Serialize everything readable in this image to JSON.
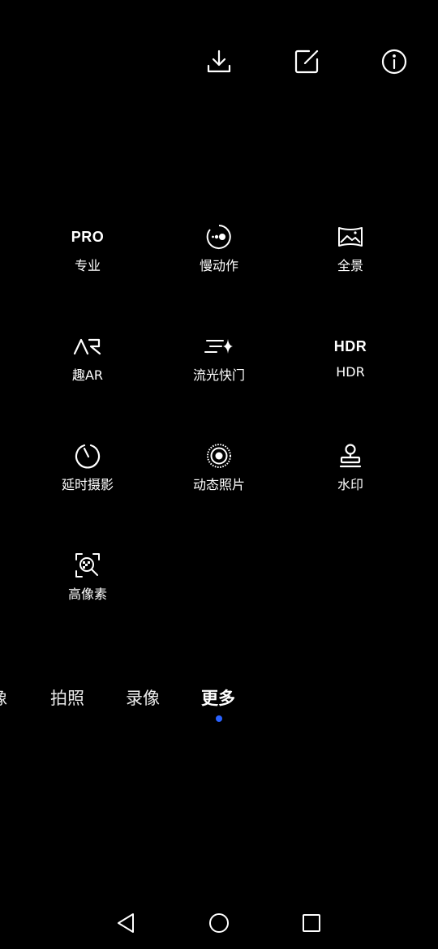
{
  "toolbar": {
    "download_icon": "download-icon",
    "edit_icon": "edit-icon",
    "info_icon": "info-icon"
  },
  "modes": [
    {
      "label": "专业",
      "icon": "pro-icon",
      "icon_text": "PRO"
    },
    {
      "label": "慢动作",
      "icon": "slow-motion-icon"
    },
    {
      "label": "全景",
      "icon": "panorama-icon"
    },
    {
      "label": "趣AR",
      "icon": "ar-icon"
    },
    {
      "label": "流光快门",
      "icon": "light-trail-icon"
    },
    {
      "label": "HDR",
      "icon": "hdr-icon",
      "icon_text": "HDR"
    },
    {
      "label": "延时摄影",
      "icon": "time-lapse-icon"
    },
    {
      "label": "动态照片",
      "icon": "live-photo-icon"
    },
    {
      "label": "水印",
      "icon": "watermark-icon"
    },
    {
      "label": "高像素",
      "icon": "high-resolution-icon"
    }
  ],
  "mode_selector": {
    "tabs": [
      {
        "label": "像"
      },
      {
        "label": "拍照"
      },
      {
        "label": "录像"
      },
      {
        "label": "更多",
        "active": true
      }
    ],
    "active_dot_color": "#2a62ff"
  },
  "nav_bar": {
    "back_icon": "back-triangle-icon",
    "home_icon": "home-circle-icon",
    "recents_icon": "recents-square-icon"
  }
}
